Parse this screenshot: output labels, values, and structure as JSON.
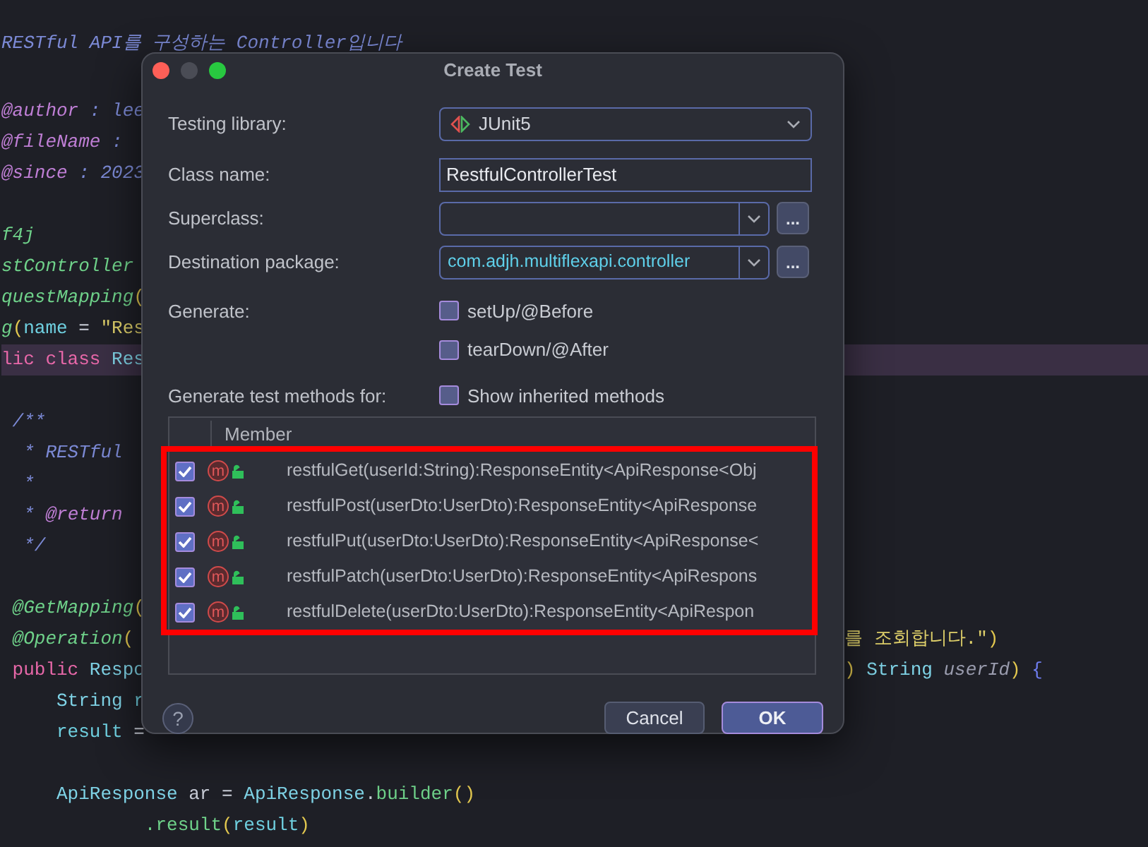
{
  "editor": {
    "lines": [
      {
        "kind": "code",
        "left": [
          {
            "kind": "doc",
            "text": "RESTful API를 구성하는 Controller입니다"
          }
        ]
      },
      {
        "kind": "blank"
      },
      {
        "kind": "code",
        "left": [
          {
            "kind": "doctag",
            "text": "@author"
          },
          {
            "kind": "doc",
            "text": " : lee"
          }
        ]
      },
      {
        "kind": "code",
        "left": [
          {
            "kind": "doctag",
            "text": "@fileName"
          },
          {
            "kind": "doc",
            "text": " :"
          }
        ]
      },
      {
        "kind": "code",
        "left": [
          {
            "kind": "doctag",
            "text": "@since"
          },
          {
            "kind": "doc",
            "text": " : 2023"
          }
        ]
      },
      {
        "kind": "blank"
      },
      {
        "kind": "code",
        "left": [
          {
            "kind": "annotation",
            "text": "f4j"
          }
        ]
      },
      {
        "kind": "code",
        "left": [
          {
            "kind": "annotation",
            "text": "stController"
          }
        ]
      },
      {
        "kind": "code",
        "left": [
          {
            "kind": "annotation",
            "text": "questMapping"
          },
          {
            "kind": "paren",
            "text": "("
          }
        ]
      },
      {
        "kind": "code",
        "left": [
          {
            "kind": "annotation",
            "text": "g"
          },
          {
            "kind": "paren",
            "text": "("
          },
          {
            "kind": "field",
            "text": "name"
          },
          {
            "kind": "plain",
            "text": " = "
          },
          {
            "kind": "string",
            "text": "\"Res"
          }
        ]
      },
      {
        "kind": "code",
        "highlighted": true,
        "left": [
          {
            "kind": "keyword",
            "text": "lic class "
          },
          {
            "kind": "type",
            "text": "Res"
          }
        ]
      },
      {
        "kind": "blank"
      },
      {
        "kind": "code",
        "left": [
          {
            "kind": "doc",
            "text": " /**"
          }
        ]
      },
      {
        "kind": "code",
        "left": [
          {
            "kind": "doc",
            "text": "  * RESTful"
          }
        ]
      },
      {
        "kind": "code",
        "left": [
          {
            "kind": "doc",
            "text": "  *"
          }
        ]
      },
      {
        "kind": "code",
        "left": [
          {
            "kind": "doc",
            "text": "  * "
          },
          {
            "kind": "doctag",
            "text": "@return"
          }
        ]
      },
      {
        "kind": "code",
        "left": [
          {
            "kind": "doc",
            "text": "  */"
          }
        ]
      },
      {
        "kind": "blank"
      },
      {
        "kind": "code",
        "left": [
          {
            "kind": "annotation",
            "text": " @GetMapping"
          },
          {
            "kind": "paren",
            "text": "("
          }
        ]
      },
      {
        "kind": "code",
        "left": [
          {
            "kind": "annotation",
            "text": " @Operation"
          },
          {
            "kind": "paren",
            "text": "("
          }
        ],
        "right": [
          {
            "kind": "string",
            "text": "를 조회합니다.\""
          },
          {
            "kind": "paren",
            "text": ")"
          }
        ]
      },
      {
        "kind": "code",
        "left": [
          {
            "kind": "keyword",
            "text": " public "
          },
          {
            "kind": "type",
            "text": "Respo"
          }
        ],
        "right": [
          {
            "kind": "paren",
            "text": ")"
          },
          {
            "kind": "type",
            "text": " String "
          },
          {
            "kind": "param",
            "text": "userId"
          },
          {
            "kind": "paren",
            "text": ")"
          },
          {
            "kind": "brace",
            "text": " {"
          }
        ]
      },
      {
        "kind": "code",
        "left": [
          {
            "kind": "type",
            "text": "     String "
          },
          {
            "kind": "field",
            "text": "r"
          }
        ]
      },
      {
        "kind": "code",
        "left": [
          {
            "kind": "field",
            "text": "     result"
          },
          {
            "kind": "plain",
            "text": " ="
          }
        ]
      },
      {
        "kind": "blank"
      },
      {
        "kind": "code",
        "left": [
          {
            "kind": "type",
            "text": "     ApiResponse"
          },
          {
            "kind": "plain",
            "text": " ar = "
          },
          {
            "kind": "type",
            "text": "ApiResponse"
          },
          {
            "kind": "plain",
            "text": "."
          },
          {
            "kind": "method",
            "text": "builder"
          },
          {
            "kind": "paren",
            "text": "()"
          }
        ]
      },
      {
        "kind": "code",
        "left": [
          {
            "kind": "method",
            "text": "             .result"
          },
          {
            "kind": "paren",
            "text": "("
          },
          {
            "kind": "field",
            "text": "result"
          },
          {
            "kind": "paren",
            "text": ")"
          }
        ]
      }
    ]
  },
  "dialog": {
    "title": "Create Test",
    "testing_library": {
      "label": "Testing library:",
      "value": "JUnit5"
    },
    "class_name": {
      "label": "Class name:",
      "value": "RestfulControllerTest"
    },
    "superclass": {
      "label": "Superclass:",
      "browse": "..."
    },
    "destination_package": {
      "label": "Destination package:",
      "value": "com.adjh.multiflexapi.controller",
      "browse": "..."
    },
    "generate": {
      "label": "Generate:",
      "options": [
        {
          "label": "setUp/@Before",
          "checked": false
        },
        {
          "label": "tearDown/@After",
          "checked": false
        }
      ]
    },
    "methods_for": {
      "label": "Generate test methods for:",
      "option": {
        "label": "Show inherited methods",
        "checked": false
      }
    },
    "table": {
      "column": "Member",
      "rows": [
        {
          "badge": "m",
          "text": "restfulGet(userId:String):ResponseEntity<ApiResponse<Obj",
          "checked": true
        },
        {
          "badge": "m",
          "text": "restfulPost(userDto:UserDto):ResponseEntity<ApiResponse",
          "checked": true
        },
        {
          "badge": "m",
          "text": "restfulPut(userDto:UserDto):ResponseEntity<ApiResponse<",
          "checked": true
        },
        {
          "badge": "m",
          "text": "restfulPatch(userDto:UserDto):ResponseEntity<ApiRespons",
          "checked": true
        },
        {
          "badge": "m",
          "text": "restfulDelete(userDto:UserDto):ResponseEntity<ApiRespon",
          "checked": true
        }
      ]
    },
    "help": "?",
    "buttons": [
      {
        "label": "Cancel",
        "default": false
      },
      {
        "label": "OK",
        "default": true
      }
    ]
  }
}
